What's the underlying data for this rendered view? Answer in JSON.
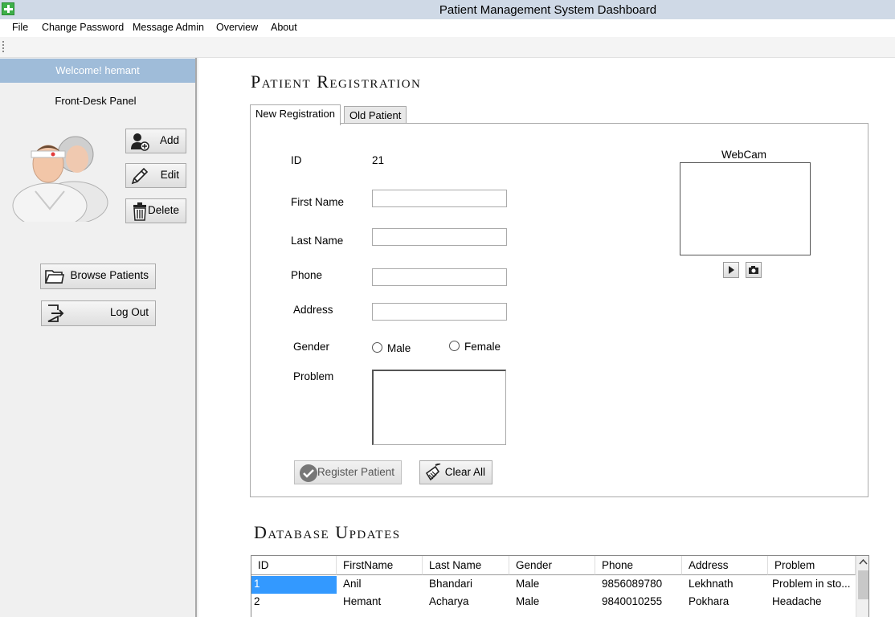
{
  "window": {
    "title": "Patient Management System Dashboard"
  },
  "menu": {
    "file": "File",
    "change_password": "Change Password",
    "message_admin": "Message Admin",
    "overview": "Overview",
    "about": "About"
  },
  "sidebar": {
    "welcome": "Welcome! hemant",
    "panel_title": "Front-Desk Panel",
    "add_label": "Add",
    "edit_label": "Edit",
    "delete_label": "Delete",
    "browse_label": "Browse Patients",
    "logout_label": "Log Out"
  },
  "registration": {
    "heading": "Patient Registration",
    "tabs": {
      "new": "New Registration",
      "old": "Old Patient"
    },
    "id_label": "ID",
    "id_value": "21",
    "first_name_label": "First Name",
    "last_name_label": "Last Name",
    "phone_label": "Phone",
    "address_label": "Address",
    "gender_label": "Gender",
    "gender_male": "Male",
    "gender_female": "Female",
    "problem_label": "Problem",
    "webcam_label": "WebCam",
    "register_label": "Register Patient",
    "clear_label": "Clear All"
  },
  "database": {
    "heading": "Database Updates",
    "columns": [
      "ID",
      "FirstName",
      "Last Name",
      "Gender",
      "Phone",
      "Address",
      "Problem"
    ],
    "rows": [
      [
        "1",
        "Anil",
        "Bhandari",
        "Male",
        "9856089780",
        "Lekhnath",
        "Problem in sto..."
      ],
      [
        "2",
        "Hemant",
        "Acharya",
        "Male",
        "9840010255",
        "Pokhara",
        "Headache"
      ]
    ]
  },
  "colors": {
    "titlebar": "#cfd9e6",
    "welcome_bar": "#9fbcd9",
    "selected_cell": "#3399ff"
  },
  "icons": [
    "plus-icon",
    "add-user-icon",
    "pencil-icon",
    "trash-icon",
    "folder-icon",
    "logout-icon",
    "play-icon",
    "camera-icon",
    "checkmark-icon",
    "broom-icon",
    "scroll-up-icon"
  ]
}
